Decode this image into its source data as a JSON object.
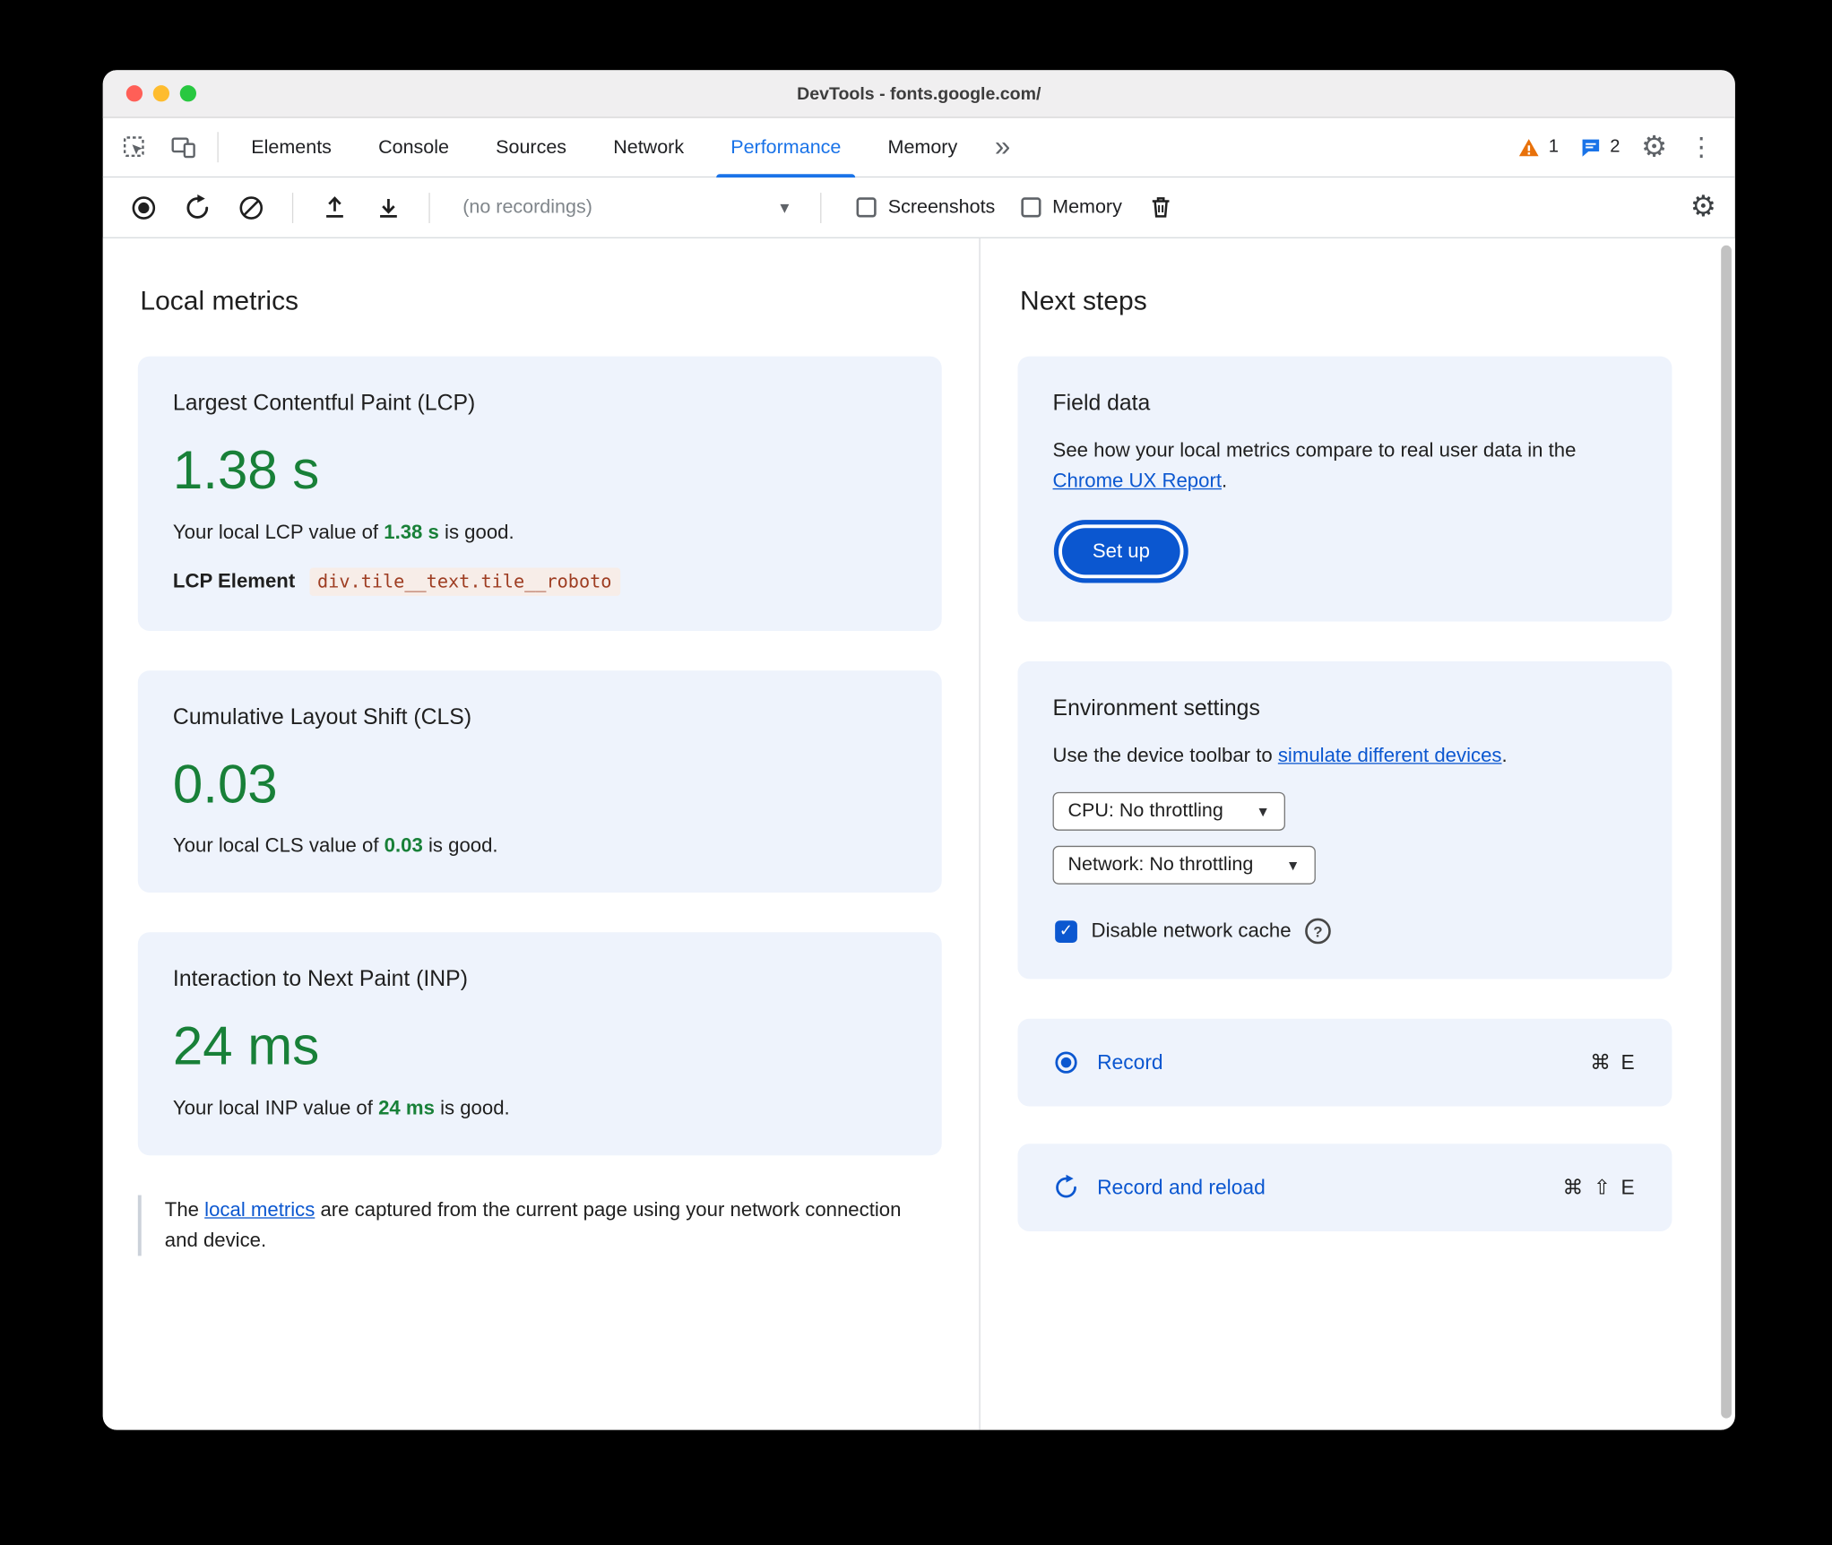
{
  "window": {
    "title": "DevTools - fonts.google.com/"
  },
  "tab_bar": {
    "tabs": [
      "Elements",
      "Console",
      "Sources",
      "Network",
      "Performance",
      "Memory"
    ],
    "active_tab": "Performance",
    "more_tabs_glyph": "»",
    "warning_count": "1",
    "issues_count": "2"
  },
  "toolbar": {
    "recordings_dropdown": "(no recordings)",
    "screenshots": {
      "label": "Screenshots",
      "checked": false
    },
    "memory": {
      "label": "Memory",
      "checked": false
    }
  },
  "icons": {
    "gear": "⚙",
    "kebab": "⋮",
    "dropdown_arrow": "▼",
    "help": "?"
  },
  "local_metrics": {
    "heading": "Local metrics",
    "lcp": {
      "title": "Largest Contentful Paint (LCP)",
      "value": "1.38 s",
      "desc_prefix": "Your local LCP value of ",
      "desc_highlight": "1.38 s",
      "desc_suffix": " is good.",
      "element_label": "LCP Element",
      "element_selector": "div.tile__text.tile__roboto"
    },
    "cls": {
      "title": "Cumulative Layout Shift (CLS)",
      "value": "0.03",
      "desc_prefix": "Your local CLS value of ",
      "desc_highlight": "0.03",
      "desc_suffix": " is good."
    },
    "inp": {
      "title": "Interaction to Next Paint (INP)",
      "value": "24 ms",
      "desc_prefix": "Your local INP value of ",
      "desc_highlight": "24 ms",
      "desc_suffix": " is good."
    },
    "footnote": {
      "prefix": "The ",
      "link_text": "local metrics",
      "suffix": " are captured from the current page using your network connection and device."
    }
  },
  "next_steps": {
    "heading": "Next steps",
    "field_data": {
      "title": "Field data",
      "desc_prefix": "See how your local metrics compare to real user data in the ",
      "link_text": "Chrome UX Report",
      "desc_suffix": ".",
      "setup_button": "Set up"
    },
    "environment_settings": {
      "title": "Environment settings",
      "desc_prefix": "Use the device toolbar to ",
      "link_text": "simulate different devices",
      "desc_suffix": ".",
      "cpu_dropdown": "CPU: No throttling",
      "network_dropdown": "Network: No throttling",
      "disable_cache": {
        "label": "Disable network cache",
        "checked": true
      }
    },
    "record": {
      "label": "Record",
      "shortcut": "⌘ E"
    },
    "record_and_reload": {
      "label": "Record and reload",
      "shortcut": "⌘ ⇧ E"
    }
  },
  "colors": {
    "accent_blue": "#0b57d0",
    "tab_blue": "#1a73e8",
    "good_green": "#188038",
    "card_bg": "#eef3fc",
    "warning_orange": "#e8710a"
  }
}
